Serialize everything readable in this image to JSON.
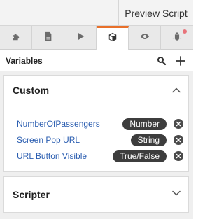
{
  "topbar": {
    "preview_label": "Preview Script"
  },
  "tabs": [
    {
      "icon": "puzzle-icon"
    },
    {
      "icon": "document-icon"
    },
    {
      "icon": "play-icon"
    },
    {
      "icon": "cube-icon",
      "active": true
    },
    {
      "icon": "eye-icon"
    },
    {
      "icon": "bug-icon",
      "notification": true
    }
  ],
  "variables": {
    "title": "Variables",
    "search_icon": "search-icon",
    "add_icon": "plus-icon"
  },
  "custom": {
    "title": "Custom",
    "expanded": true,
    "rows": [
      {
        "name": "NumberOfPassengers",
        "type": "Number"
      },
      {
        "name": "Screen Pop URL",
        "type": "String"
      },
      {
        "name": "URL Button Visible",
        "type": "True/False"
      }
    ]
  },
  "scripter": {
    "title": "Scripter",
    "expanded": false
  },
  "colors": {
    "accent": "#e8702a",
    "link": "#2a5db0",
    "badge": "#3d3d3d",
    "notification": "#e8737a"
  }
}
